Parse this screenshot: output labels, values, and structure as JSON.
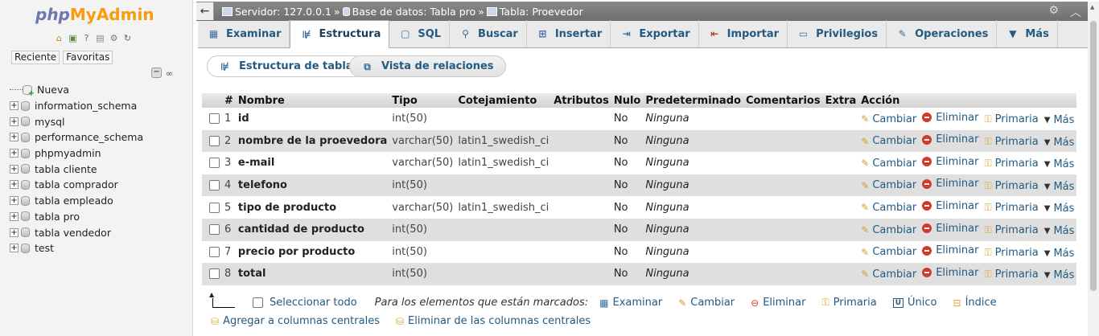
{
  "nav": {
    "logo": {
      "php": "php",
      "my": "My",
      "admin": "Admin"
    },
    "icons": [
      "home-icon",
      "logout-icon",
      "help-icon",
      "docs-icon",
      "settings-icon",
      "reload-icon"
    ],
    "tabs": [
      "Reciente",
      "Favoritas"
    ],
    "tree": [
      {
        "label": "Nueva",
        "type": "new"
      },
      {
        "label": "information_schema",
        "type": "db"
      },
      {
        "label": "mysql",
        "type": "db"
      },
      {
        "label": "performance_schema",
        "type": "db"
      },
      {
        "label": "phpmyadmin",
        "type": "db"
      },
      {
        "label": "tabla cliente",
        "type": "db"
      },
      {
        "label": "tabla comprador",
        "type": "db"
      },
      {
        "label": "tabla empleado",
        "type": "db"
      },
      {
        "label": "tabla pro",
        "type": "db"
      },
      {
        "label": "tabla vendedor",
        "type": "db"
      },
      {
        "label": "test",
        "type": "db"
      }
    ]
  },
  "breadcrumb": {
    "server": "Servidor: 127.0.0.1",
    "database": "Base de datos: Tabla pro",
    "table": "Tabla: Proevedor"
  },
  "tabs": [
    {
      "label": "Examinar",
      "icon": "browse-icon"
    },
    {
      "label": "Estructura",
      "icon": "structure-icon",
      "active": true
    },
    {
      "label": "SQL",
      "icon": "sql-icon"
    },
    {
      "label": "Buscar",
      "icon": "search-icon"
    },
    {
      "label": "Insertar",
      "icon": "insert-icon"
    },
    {
      "label": "Exportar",
      "icon": "export-icon"
    },
    {
      "label": "Importar",
      "icon": "import-icon"
    },
    {
      "label": "Privilegios",
      "icon": "privileges-icon"
    },
    {
      "label": "Operaciones",
      "icon": "operations-icon"
    },
    {
      "label": "Más",
      "icon": "more-icon"
    }
  ],
  "subtabs": {
    "structure": "Estructura de tabla",
    "relations": "Vista de relaciones"
  },
  "table": {
    "headers": [
      "#",
      "Nombre",
      "Tipo",
      "Cotejamiento",
      "Atributos",
      "Nulo",
      "Predeterminado",
      "Comentarios",
      "Extra",
      "Acción"
    ],
    "rows": [
      {
        "num": "1",
        "name": "id",
        "type": "int(50)",
        "collation": "",
        "null": "No",
        "default": "Ninguna"
      },
      {
        "num": "2",
        "name": "nombre de la proevedora",
        "type": "varchar(50)",
        "collation": "latin1_swedish_ci",
        "null": "No",
        "default": "Ninguna"
      },
      {
        "num": "3",
        "name": "e-mail",
        "type": "varchar(50)",
        "collation": "latin1_swedish_ci",
        "null": "No",
        "default": "Ninguna"
      },
      {
        "num": "4",
        "name": "telefono",
        "type": "int(50)",
        "collation": "",
        "null": "No",
        "default": "Ninguna"
      },
      {
        "num": "5",
        "name": "tipo de producto",
        "type": "varchar(50)",
        "collation": "latin1_swedish_ci",
        "null": "No",
        "default": "Ninguna"
      },
      {
        "num": "6",
        "name": "cantidad de producto",
        "type": "int(50)",
        "collation": "",
        "null": "No",
        "default": "Ninguna"
      },
      {
        "num": "7",
        "name": "precio por producto",
        "type": "int(50)",
        "collation": "",
        "null": "No",
        "default": "Ninguna"
      },
      {
        "num": "8",
        "name": "total",
        "type": "int(50)",
        "collation": "",
        "null": "No",
        "default": "Ninguna"
      }
    ],
    "actions": {
      "change": "Cambiar",
      "drop": "Eliminar",
      "primary": "Primaria",
      "more": "Más"
    }
  },
  "footer": {
    "select_all": "Seleccionar todo",
    "with_selected": "Para los elementos que están marcados:",
    "actions": [
      {
        "label": "Examinar",
        "icon": "browse-icon"
      },
      {
        "label": "Cambiar",
        "icon": "pencil-icon"
      },
      {
        "label": "Eliminar",
        "icon": "delete-icon"
      },
      {
        "label": "Primaria",
        "icon": "key-icon"
      },
      {
        "label": "Único",
        "icon": "unique-icon"
      },
      {
        "label": "Índice",
        "icon": "index-icon"
      }
    ],
    "add_central": "Agregar a columnas centrales",
    "remove_central": "Eliminar de las columnas centrales"
  },
  "colors": {
    "link": "#235a81",
    "topbar": "#7b7b7b",
    "row_alt": "#dfdfdf"
  }
}
